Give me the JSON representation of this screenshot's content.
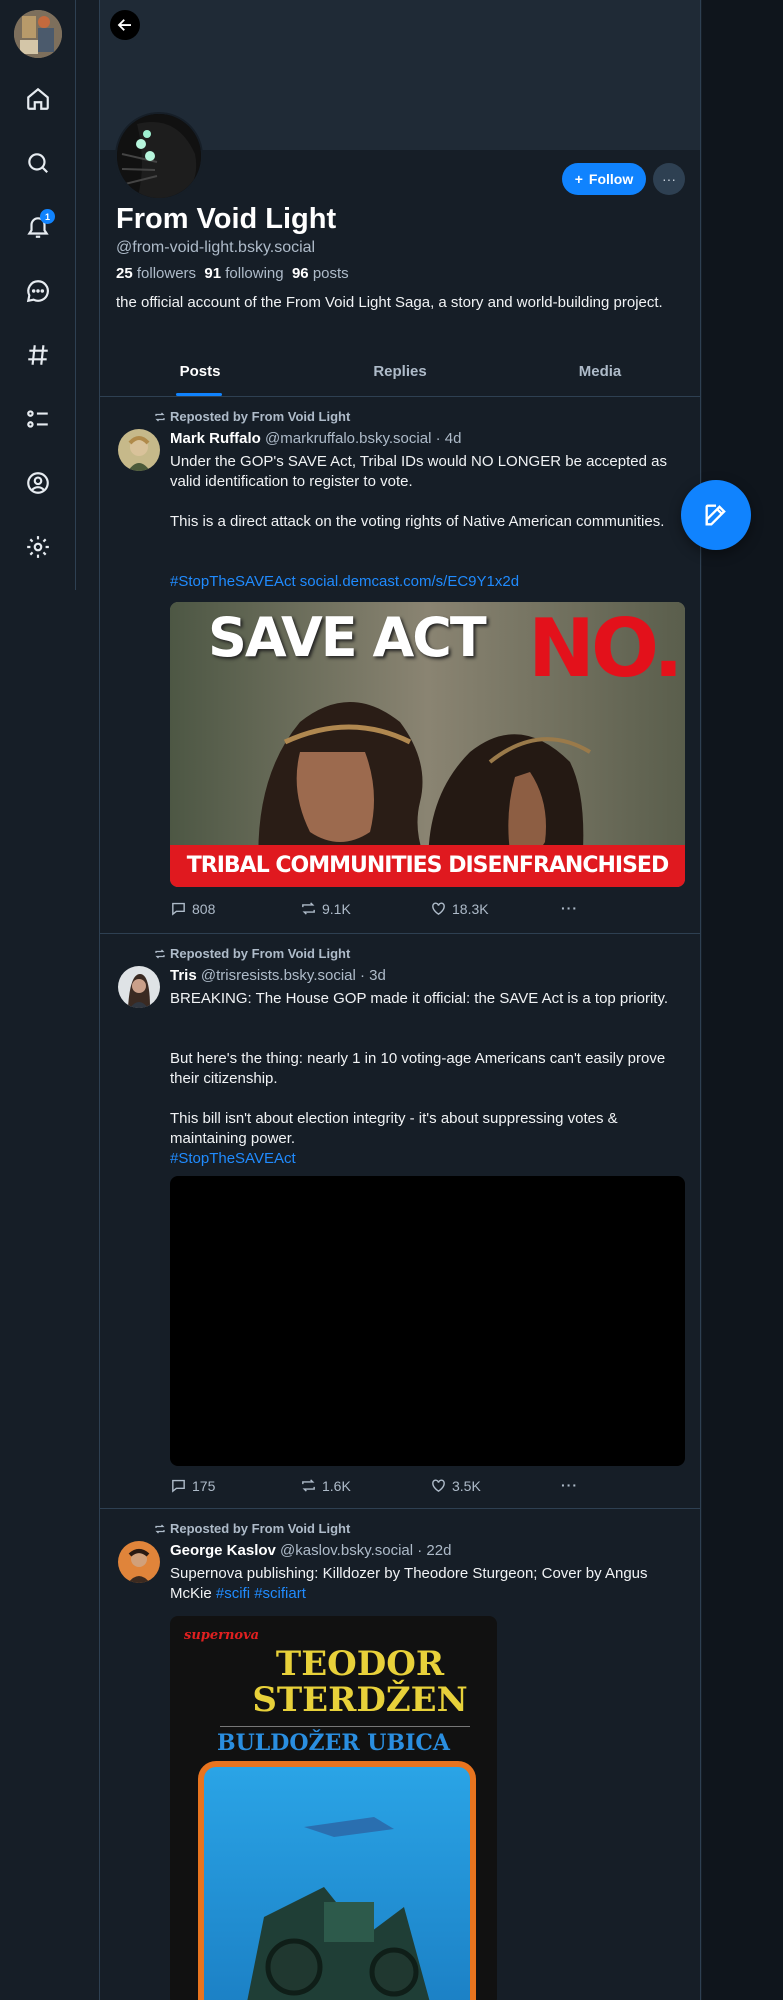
{
  "nav": {
    "notifications_badge": "1",
    "items": [
      "home-icon",
      "search-icon",
      "bell-icon",
      "chat-icon",
      "hashtag-icon",
      "list-icon",
      "profile-icon",
      "gear-icon"
    ]
  },
  "profile": {
    "display_name": "From Void Light",
    "handle": "@from-void-light.bsky.social",
    "followers_count": "25",
    "followers_label": "followers",
    "following_count": "91",
    "following_label": "following",
    "posts_count": "96",
    "posts_label": "posts",
    "bio": "the official account of the From Void Light Saga, a story and world-building project.",
    "follow_label": "Follow",
    "more_label": "···"
  },
  "tabs": [
    {
      "label": "Posts",
      "active": true
    },
    {
      "label": "Replies",
      "active": false
    },
    {
      "label": "Media",
      "active": false
    }
  ],
  "posts": [
    {
      "repost_label": "Reposted by From Void Light",
      "author_name": "Mark Ruffalo",
      "author_handle": "@markruffalo.bsky.social",
      "time": "· 4d",
      "text_1": "Under the GOP's SAVE Act, Tribal IDs would NO LONGER be accepted as valid identification to register to vote.",
      "text_2": "This is a direct attack on the voting rights of Native American communities.",
      "hashtag": "#StopTheSAVEAct",
      "link": "social.demcast.com/s/EC9Y1x2d",
      "image_title_white": "SAVE ACT",
      "image_title_red": "NO.",
      "image_caption": "TRIBAL COMMUNITIES DISENFRANCHISED",
      "replies": "808",
      "reposts": "9.1K",
      "likes": "18.3K"
    },
    {
      "repost_label": "Reposted by From Void Light",
      "author_name": "Tris",
      "author_handle": "@trisresists.bsky.social",
      "time": "· 3d",
      "text_1": "BREAKING: The House GOP made it official: the SAVE Act is a top priority.",
      "text_2": "But here's the thing: nearly 1 in 10 voting-age Americans can't easily prove their citizenship.",
      "text_3": "This bill isn't about election integrity - it's about suppressing votes & maintaining power.",
      "hashtag": "#StopTheSAVEAct",
      "replies": "175",
      "reposts": "1.6K",
      "likes": "3.5K"
    },
    {
      "repost_label": "Reposted by From Void Light",
      "author_name": "George Kaslov",
      "author_handle": "@kaslov.bsky.social",
      "time": "· 22d",
      "text_1": "Supernova publishing: Killdozer by Theodore Sturgeon; Cover by Angus McKie",
      "hashtag_1": "#scifi",
      "hashtag_2": "#scifiart",
      "cover_publisher": "supernova",
      "cover_author_1": "TEODOR",
      "cover_author_2": "STERDŽEN",
      "cover_title": "BULDOŽER UBICA"
    }
  ]
}
